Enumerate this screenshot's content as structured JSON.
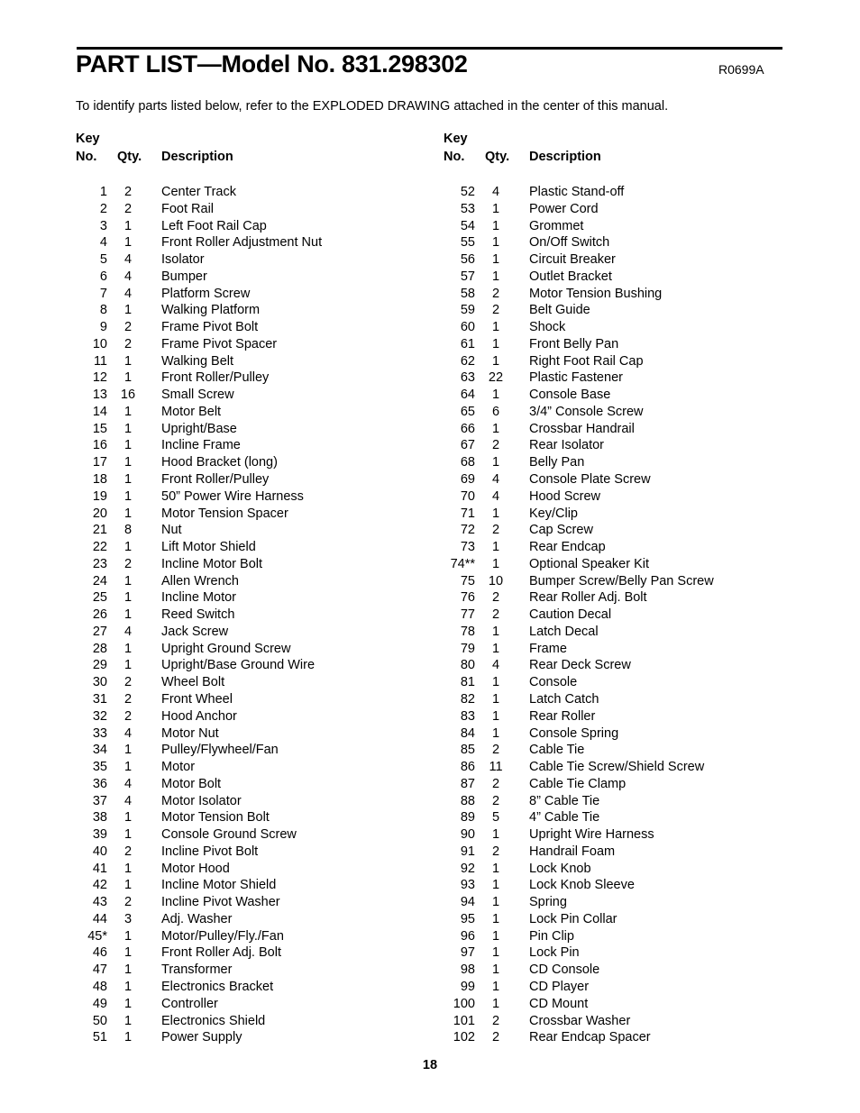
{
  "document": {
    "title": "PART LIST—Model No. 831.298302",
    "revision_code": "R0699A",
    "intro": "To identify parts listed below, refer to the EXPLODED DRAWING attached in the center of this manual.",
    "page_number": "18"
  },
  "columns": {
    "headers": {
      "key_word": "Key",
      "no_word": "No.",
      "qty_word": "Qty.",
      "desc_word": "Description"
    },
    "left": [
      {
        "key": "1",
        "qty": "2",
        "desc": "Center Track"
      },
      {
        "key": "2",
        "qty": "2",
        "desc": "Foot Rail"
      },
      {
        "key": "3",
        "qty": "1",
        "desc": "Left Foot Rail Cap"
      },
      {
        "key": "4",
        "qty": "1",
        "desc": "Front Roller Adjustment Nut"
      },
      {
        "key": "5",
        "qty": "4",
        "desc": "Isolator"
      },
      {
        "key": "6",
        "qty": "4",
        "desc": "Bumper"
      },
      {
        "key": "7",
        "qty": "4",
        "desc": "Platform Screw"
      },
      {
        "key": "8",
        "qty": "1",
        "desc": "Walking Platform"
      },
      {
        "key": "9",
        "qty": "2",
        "desc": "Frame Pivot Bolt"
      },
      {
        "key": "10",
        "qty": "2",
        "desc": "Frame Pivot Spacer"
      },
      {
        "key": "11",
        "qty": "1",
        "desc": "Walking Belt"
      },
      {
        "key": "12",
        "qty": "1",
        "desc": "Front Roller/Pulley"
      },
      {
        "key": "13",
        "qty": "16",
        "desc": "Small Screw"
      },
      {
        "key": "14",
        "qty": "1",
        "desc": "Motor Belt"
      },
      {
        "key": "15",
        "qty": "1",
        "desc": "Upright/Base"
      },
      {
        "key": "16",
        "qty": "1",
        "desc": "Incline Frame"
      },
      {
        "key": "17",
        "qty": "1",
        "desc": "Hood Bracket (long)"
      },
      {
        "key": "18",
        "qty": "1",
        "desc": "Front Roller/Pulley"
      },
      {
        "key": "19",
        "qty": "1",
        "desc": "50” Power Wire Harness"
      },
      {
        "key": "20",
        "qty": "1",
        "desc": "Motor Tension Spacer"
      },
      {
        "key": "21",
        "qty": "8",
        "desc": "Nut"
      },
      {
        "key": "22",
        "qty": "1",
        "desc": "Lift Motor Shield"
      },
      {
        "key": "23",
        "qty": "2",
        "desc": "Incline Motor Bolt"
      },
      {
        "key": "24",
        "qty": "1",
        "desc": "Allen Wrench"
      },
      {
        "key": "25",
        "qty": "1",
        "desc": "Incline Motor"
      },
      {
        "key": "26",
        "qty": "1",
        "desc": "Reed Switch"
      },
      {
        "key": "27",
        "qty": "4",
        "desc": "Jack Screw"
      },
      {
        "key": "28",
        "qty": "1",
        "desc": "Upright Ground Screw"
      },
      {
        "key": "29",
        "qty": "1",
        "desc": "Upright/Base Ground Wire"
      },
      {
        "key": "30",
        "qty": "2",
        "desc": "Wheel Bolt"
      },
      {
        "key": "31",
        "qty": "2",
        "desc": "Front Wheel"
      },
      {
        "key": "32",
        "qty": "2",
        "desc": "Hood Anchor"
      },
      {
        "key": "33",
        "qty": "4",
        "desc": "Motor Nut"
      },
      {
        "key": "34",
        "qty": "1",
        "desc": "Pulley/Flywheel/Fan"
      },
      {
        "key": "35",
        "qty": "1",
        "desc": "Motor"
      },
      {
        "key": "36",
        "qty": "4",
        "desc": "Motor Bolt"
      },
      {
        "key": "37",
        "qty": "4",
        "desc": "Motor Isolator"
      },
      {
        "key": "38",
        "qty": "1",
        "desc": "Motor Tension Bolt"
      },
      {
        "key": "39",
        "qty": "1",
        "desc": "Console Ground Screw"
      },
      {
        "key": "40",
        "qty": "2",
        "desc": "Incline Pivot Bolt"
      },
      {
        "key": "41",
        "qty": "1",
        "desc": "Motor Hood"
      },
      {
        "key": "42",
        "qty": "1",
        "desc": "Incline Motor Shield"
      },
      {
        "key": "43",
        "qty": "2",
        "desc": "Incline Pivot Washer"
      },
      {
        "key": "44",
        "qty": "3",
        "desc": "Adj. Washer"
      },
      {
        "key": "45*",
        "qty": "1",
        "desc": "Motor/Pulley/Fly./Fan"
      },
      {
        "key": "46",
        "qty": "1",
        "desc": "Front Roller Adj. Bolt"
      },
      {
        "key": "47",
        "qty": "1",
        "desc": "Transformer"
      },
      {
        "key": "48",
        "qty": "1",
        "desc": "Electronics Bracket"
      },
      {
        "key": "49",
        "qty": "1",
        "desc": "Controller"
      },
      {
        "key": "50",
        "qty": "1",
        "desc": "Electronics Shield"
      },
      {
        "key": "51",
        "qty": "1",
        "desc": "Power Supply"
      }
    ],
    "right": [
      {
        "key": "52",
        "qty": "4",
        "desc": "Plastic Stand-off"
      },
      {
        "key": "53",
        "qty": "1",
        "desc": "Power Cord"
      },
      {
        "key": "54",
        "qty": "1",
        "desc": "Grommet"
      },
      {
        "key": "55",
        "qty": "1",
        "desc": "On/Off Switch"
      },
      {
        "key": "56",
        "qty": "1",
        "desc": "Circuit Breaker"
      },
      {
        "key": "57",
        "qty": "1",
        "desc": "Outlet Bracket"
      },
      {
        "key": "58",
        "qty": "2",
        "desc": "Motor Tension Bushing"
      },
      {
        "key": "59",
        "qty": "2",
        "desc": "Belt Guide"
      },
      {
        "key": "60",
        "qty": "1",
        "desc": "Shock"
      },
      {
        "key": "61",
        "qty": "1",
        "desc": "Front Belly Pan"
      },
      {
        "key": "62",
        "qty": "1",
        "desc": "Right Foot Rail Cap"
      },
      {
        "key": "63",
        "qty": "22",
        "desc": "Plastic Fastener"
      },
      {
        "key": "64",
        "qty": "1",
        "desc": "Console Base"
      },
      {
        "key": "65",
        "qty": "6",
        "desc": "3/4” Console Screw"
      },
      {
        "key": "66",
        "qty": "1",
        "desc": "Crossbar Handrail"
      },
      {
        "key": "67",
        "qty": "2",
        "desc": "Rear Isolator"
      },
      {
        "key": "68",
        "qty": "1",
        "desc": "Belly Pan"
      },
      {
        "key": "69",
        "qty": "4",
        "desc": "Console Plate Screw"
      },
      {
        "key": "70",
        "qty": "4",
        "desc": "Hood Screw"
      },
      {
        "key": "71",
        "qty": "1",
        "desc": "Key/Clip"
      },
      {
        "key": "72",
        "qty": "2",
        "desc": "Cap Screw"
      },
      {
        "key": "73",
        "qty": "1",
        "desc": "Rear Endcap"
      },
      {
        "key": "74**",
        "qty": "1",
        "desc": "Optional Speaker Kit"
      },
      {
        "key": "75",
        "qty": "10",
        "desc": "Bumper Screw/Belly Pan Screw"
      },
      {
        "key": "76",
        "qty": "2",
        "desc": "Rear Roller Adj. Bolt"
      },
      {
        "key": "77",
        "qty": "2",
        "desc": "Caution Decal"
      },
      {
        "key": "78",
        "qty": "1",
        "desc": "Latch Decal"
      },
      {
        "key": "79",
        "qty": "1",
        "desc": "Frame"
      },
      {
        "key": "80",
        "qty": "4",
        "desc": "Rear Deck Screw"
      },
      {
        "key": "81",
        "qty": "1",
        "desc": "Console"
      },
      {
        "key": "82",
        "qty": "1",
        "desc": "Latch Catch"
      },
      {
        "key": "83",
        "qty": "1",
        "desc": "Rear Roller"
      },
      {
        "key": "84",
        "qty": "1",
        "desc": "Console Spring"
      },
      {
        "key": "85",
        "qty": "2",
        "desc": "Cable Tie"
      },
      {
        "key": "86",
        "qty": "11",
        "desc": "Cable Tie Screw/Shield Screw"
      },
      {
        "key": "87",
        "qty": "2",
        "desc": "Cable Tie Clamp"
      },
      {
        "key": "88",
        "qty": "2",
        "desc": "8” Cable Tie"
      },
      {
        "key": "89",
        "qty": "5",
        "desc": "4” Cable Tie"
      },
      {
        "key": "90",
        "qty": "1",
        "desc": "Upright Wire Harness"
      },
      {
        "key": "91",
        "qty": "2",
        "desc": "Handrail Foam"
      },
      {
        "key": "92",
        "qty": "1",
        "desc": "Lock Knob"
      },
      {
        "key": "93",
        "qty": "1",
        "desc": "Lock Knob Sleeve"
      },
      {
        "key": "94",
        "qty": "1",
        "desc": "Spring"
      },
      {
        "key": "95",
        "qty": "1",
        "desc": "Lock Pin Collar"
      },
      {
        "key": "96",
        "qty": "1",
        "desc": "Pin Clip"
      },
      {
        "key": "97",
        "qty": "1",
        "desc": "Lock Pin"
      },
      {
        "key": "98",
        "qty": "1",
        "desc": "CD Console"
      },
      {
        "key": "99",
        "qty": "1",
        "desc": "CD Player"
      },
      {
        "key": "100",
        "qty": "1",
        "desc": "CD Mount"
      },
      {
        "key": "101",
        "qty": "2",
        "desc": "Crossbar Washer"
      },
      {
        "key": "102",
        "qty": "2",
        "desc": "Rear Endcap Spacer"
      }
    ]
  }
}
